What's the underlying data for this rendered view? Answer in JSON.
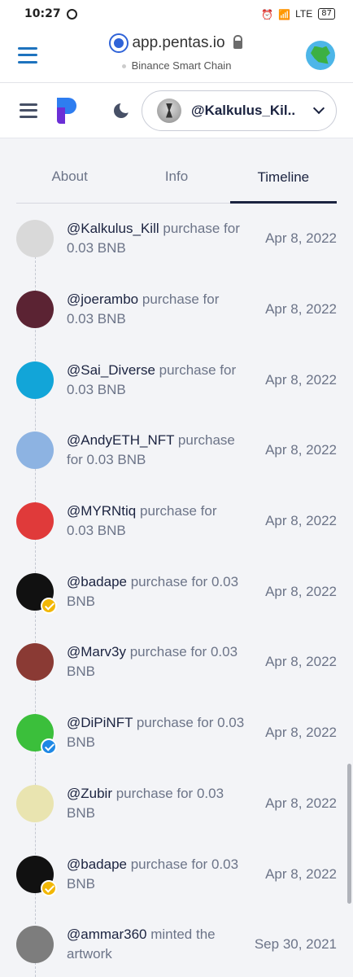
{
  "status_bar": {
    "time": "10:27",
    "battery": "87",
    "network": "LTE"
  },
  "browser": {
    "url": "app.pentas.io",
    "subtitle": "Binance Smart Chain"
  },
  "app_header": {
    "username": "@Kalkulus_Kil..",
    "logo_colors": {
      "top": "#2e7df0",
      "bottom": "#6b2fd6"
    }
  },
  "tabs": [
    {
      "label": "About",
      "active": false
    },
    {
      "label": "Info",
      "active": false
    },
    {
      "label": "Timeline",
      "active": true
    }
  ],
  "timeline": [
    {
      "user": "@Kalkulus_Kill",
      "action": " purchase for 0.03 BNB",
      "date": "Apr 8, 2022",
      "avatar": "hourglass-avatar",
      "verified": false,
      "bg": "#d9d9d9"
    },
    {
      "user": "@joerambo",
      "action": " purchase for 0.03 BNB",
      "date": "Apr 8, 2022",
      "avatar": "anime-character-avatar",
      "verified": false,
      "bg": "#5b2333"
    },
    {
      "user": "@Sai_Diverse",
      "action": " purchase for 0.03 BNB",
      "date": "Apr 8, 2022",
      "avatar": "letter-s-avatar",
      "verified": false,
      "bg": "#12a5d8"
    },
    {
      "user": "@AndyETH_NFT",
      "action": " purchase for 0.03 BNB",
      "date": "Apr 8, 2022",
      "avatar": "cartoon-face-avatar",
      "verified": false,
      "bg": "#8db3e2"
    },
    {
      "user": "@MYRNtiq",
      "action": " purchase for 0.03 BNB",
      "date": "Apr 8, 2022",
      "avatar": "rising-sun-ape-avatar",
      "verified": false,
      "bg": "#e03a3a"
    },
    {
      "user": "@badape",
      "action": " purchase for 0.03 BNB",
      "date": "Apr 8, 2022",
      "avatar": "green-ape-avatar",
      "verified": true,
      "bg": "#111111",
      "badge": "#f2b705"
    },
    {
      "user": "@Marv3y",
      "action": " purchase for 0.03 BNB",
      "date": "Apr 8, 2022",
      "avatar": "pixel-ape-avatar",
      "verified": false,
      "bg": "#8a3a34"
    },
    {
      "user": "@DiPiNFT",
      "action": " purchase for 0.03 BNB",
      "date": "Apr 8, 2022",
      "avatar": "green-ape-cap-avatar",
      "verified": true,
      "bg": "#3bbf3b",
      "badge": "#1e88e5"
    },
    {
      "user": "@Zubir",
      "action": " purchase for 0.03 BNB",
      "date": "Apr 8, 2022",
      "avatar": "blue-doodle-avatar",
      "verified": false,
      "bg": "#e9e4b0"
    },
    {
      "user": "@badape",
      "action": " purchase for 0.03 BNB",
      "date": "Apr 8, 2022",
      "avatar": "green-ape-avatar",
      "verified": true,
      "bg": "#111111",
      "badge": "#f2b705"
    },
    {
      "user": "@ammar360",
      "action": " minted the artwork",
      "date": "Sep 30, 2021",
      "avatar": "grey-artwork-avatar",
      "verified": false,
      "bg": "#7d7d7d"
    }
  ]
}
